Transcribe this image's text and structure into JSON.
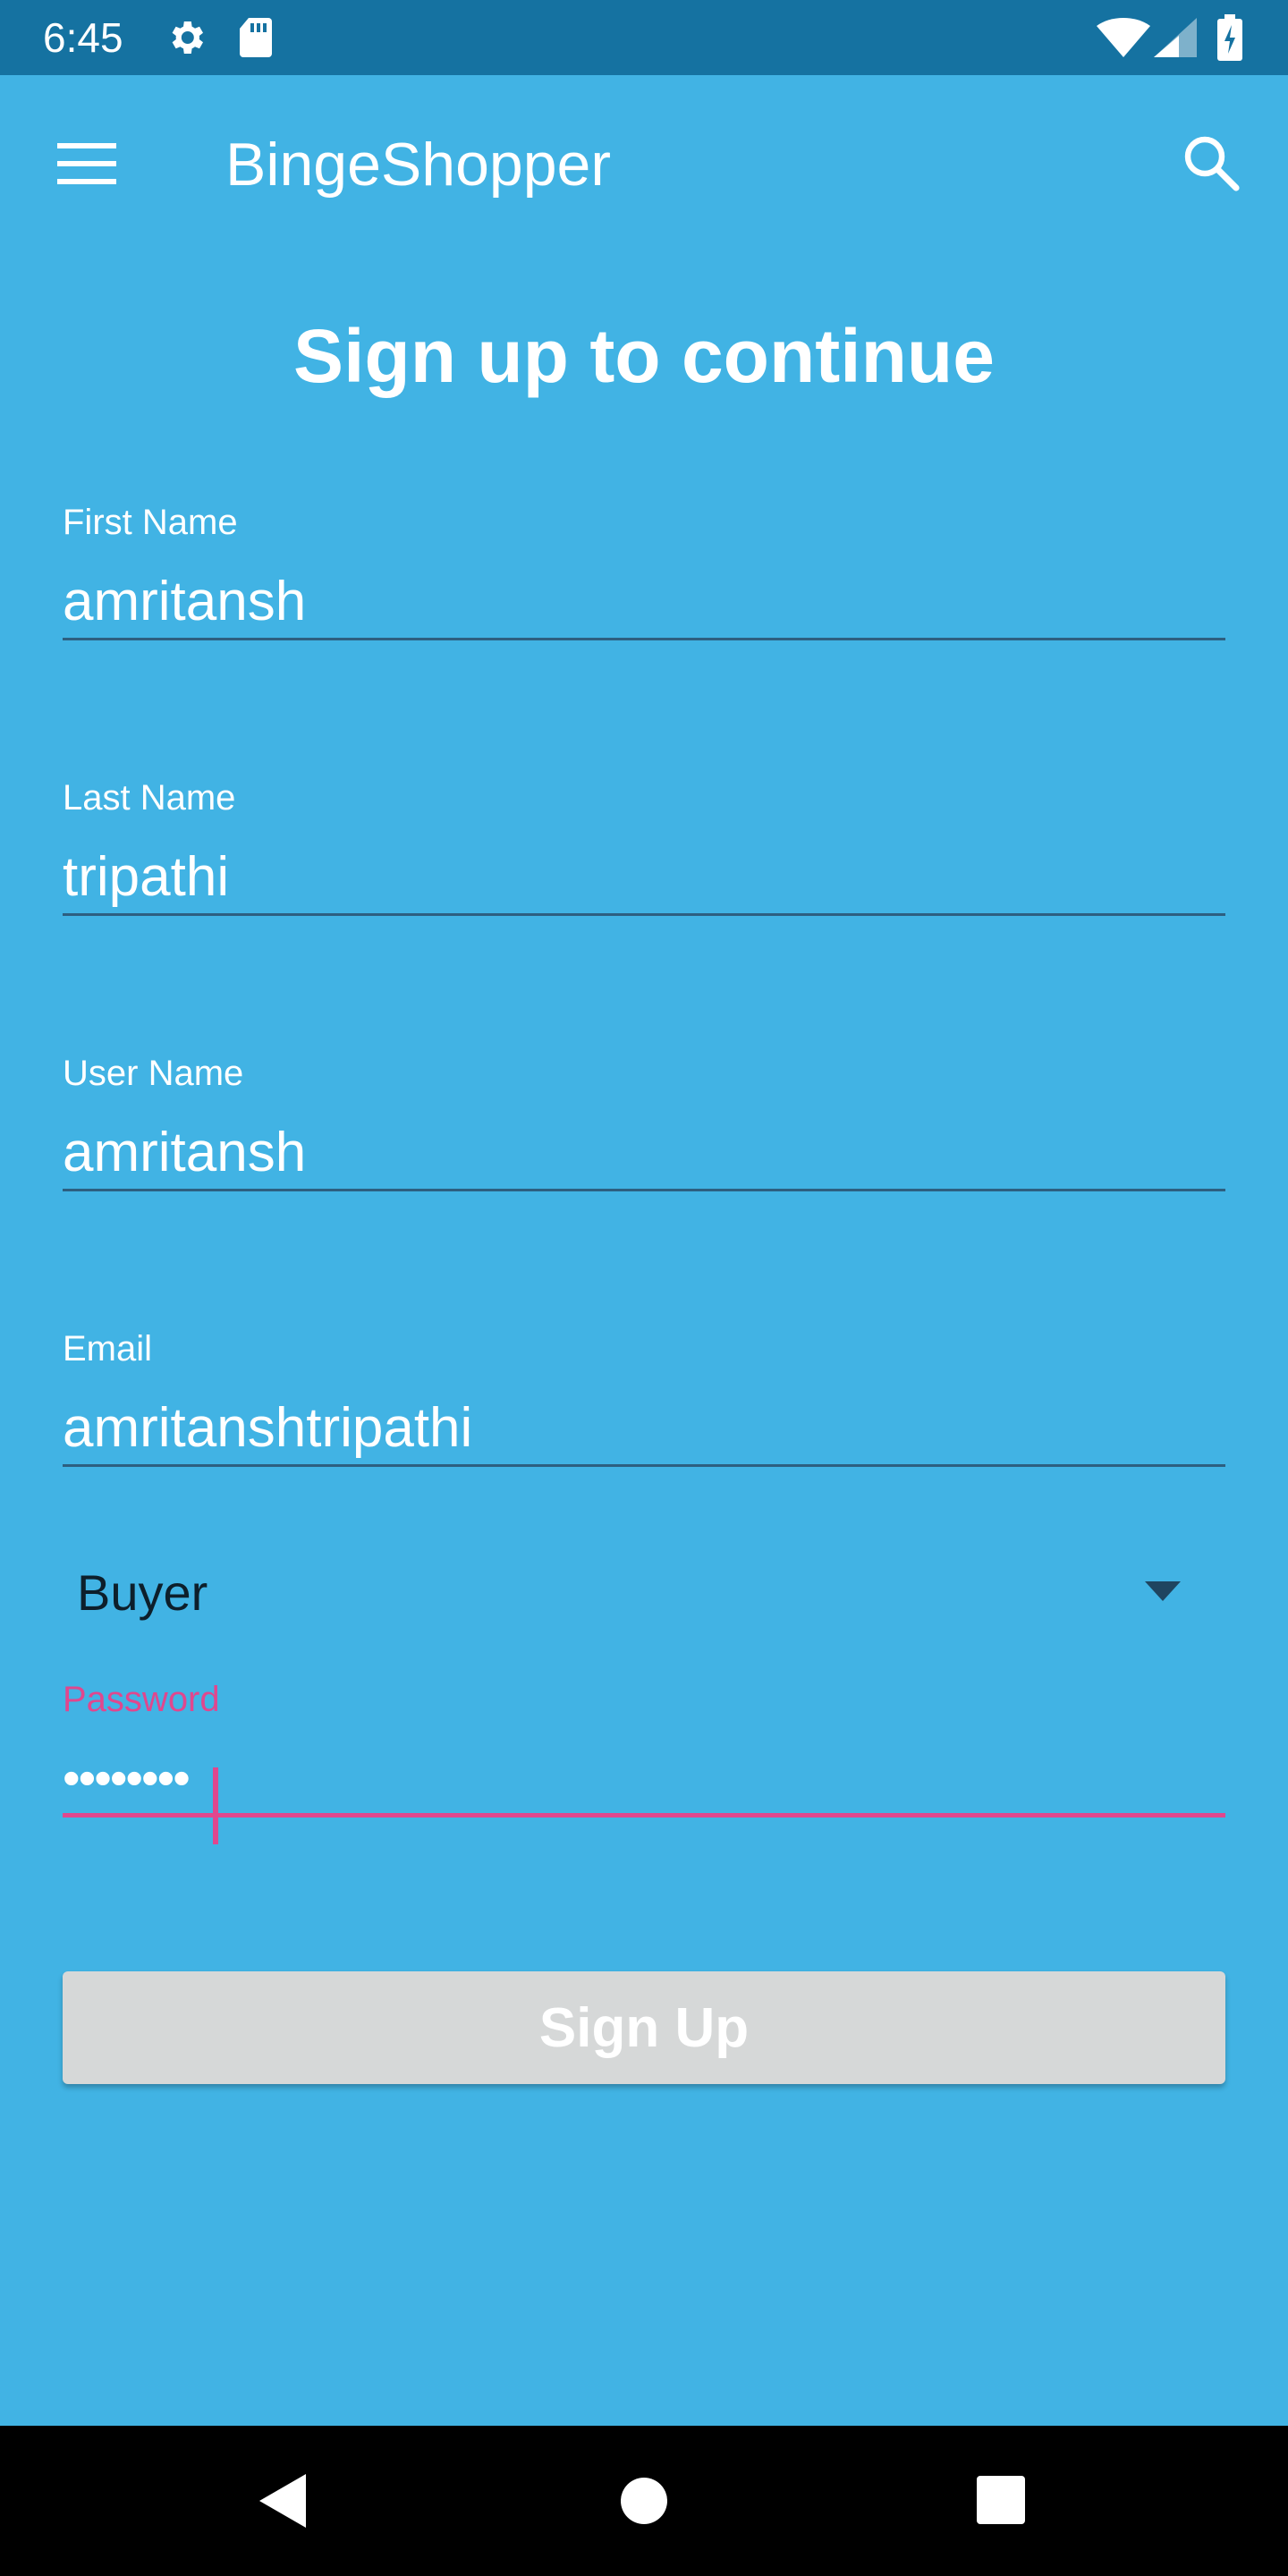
{
  "status_bar": {
    "time": "6:45",
    "icons": [
      "gear-icon",
      "sd-card-icon",
      "wifi-icon",
      "signal-icon",
      "battery-charging-icon"
    ]
  },
  "app_bar": {
    "title": "BingeShopper",
    "icons": [
      "menu-icon",
      "search-icon"
    ]
  },
  "form": {
    "title": "Sign up to continue",
    "first_name": {
      "label": "First Name",
      "value": "amritansh"
    },
    "last_name": {
      "label": "Last Name",
      "value": "tripathi"
    },
    "user_name": {
      "label": "User Name",
      "value": "amritansh"
    },
    "email": {
      "label": "Email",
      "value": "amritanshtripathi"
    },
    "role": {
      "selected": "Buyer"
    },
    "password": {
      "label": "Password",
      "value": "••••••••"
    },
    "submit_label": "Sign Up"
  },
  "nav_bar": {
    "icons": [
      "back-icon",
      "home-icon",
      "recents-icon"
    ]
  },
  "colors": {
    "background": "#41b3e4",
    "status_bar": "#1572a1",
    "accent": "#e0478e",
    "underline": "#2d5f80",
    "button_disabled": "#d6d8d8"
  }
}
